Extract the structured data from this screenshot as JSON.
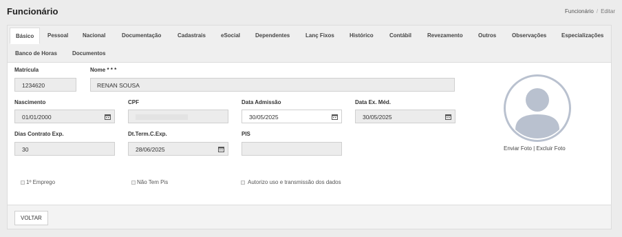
{
  "header": {
    "title": "Funcionário",
    "breadcrumb": {
      "parent": "Funcionário",
      "separator": "/",
      "current": "Editar"
    }
  },
  "tabs": [
    {
      "label": "Básico",
      "active": true
    },
    {
      "label": "Pessoal"
    },
    {
      "label": "Nacional"
    },
    {
      "label": "Documentação"
    },
    {
      "label": "Cadastrais"
    },
    {
      "label": "eSocial"
    },
    {
      "label": "Dependentes"
    },
    {
      "label": "Lanç Fixos"
    },
    {
      "label": "Histórico"
    },
    {
      "label": "Contábil"
    },
    {
      "label": "Revezamento"
    },
    {
      "label": "Outros"
    },
    {
      "label": "Observações"
    },
    {
      "label": "Especializações"
    },
    {
      "label": "Banco de Horas"
    },
    {
      "label": "Documentos"
    }
  ],
  "form": {
    "matricula": {
      "label": "Matrícula",
      "value": "1234620"
    },
    "nome": {
      "label": "Nome * * *",
      "value": "RENAN SOUSA"
    },
    "nascimento": {
      "label": "Nascimento",
      "value": "01/01/2000"
    },
    "cpf": {
      "label": "CPF",
      "value": ""
    },
    "data_admissao": {
      "label": "Data Admissão",
      "value": "30/05/2025"
    },
    "data_ex_med": {
      "label": "Data Ex. Méd.",
      "value": "30/05/2025"
    },
    "dias_contrato": {
      "label": "Dias Contrato Exp.",
      "value": "30"
    },
    "dt_term": {
      "label": "Dt.Term.C.Exp.",
      "value": "28/06/2025"
    },
    "pis": {
      "label": "PIS",
      "value": ""
    },
    "primeiro_emprego": {
      "label": "1º Emprego",
      "checked": false
    },
    "nao_tem_pis": {
      "label": "Não Tem Pis",
      "checked": false
    },
    "autorizo": {
      "label": "Autorizo uso e transmissão dos dados",
      "checked": false
    }
  },
  "photo": {
    "enviar": "Enviar Foto",
    "separator": " | ",
    "excluir": "Excluir Foto",
    "icon": "user-silhouette-icon"
  },
  "footer": {
    "voltar": "VOLTAR"
  },
  "colors": {
    "avatar": "#b9c1cf",
    "background": "#ececec",
    "field_disabled": "#ececec"
  }
}
